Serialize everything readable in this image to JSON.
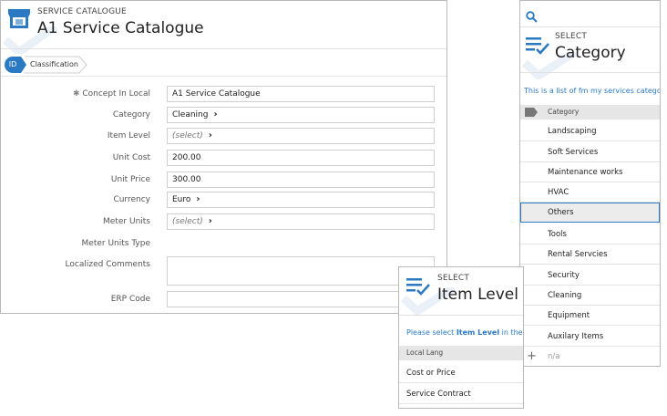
{
  "main": {
    "eyebrow": "SERVICE CATALOGUE",
    "title": "A1 Service Catalogue",
    "crumbs": {
      "id": "ID",
      "classification": "Classification"
    },
    "fields": [
      {
        "label": "Concept In Local",
        "value": "A1 Service Catalogue",
        "required": true
      },
      {
        "label": "Category",
        "value": "Cleaning",
        "chevron": true
      },
      {
        "label": "Item Level",
        "value": "(select)",
        "chevron": true,
        "placeholder": true
      },
      {
        "label": "Unit Cost",
        "value": "200.00"
      },
      {
        "label": "Unit Price",
        "value": "300.00"
      },
      {
        "label": "Currency",
        "value": "Euro",
        "chevron": true
      },
      {
        "label": "Meter Units",
        "value": "(select)",
        "chevron": true,
        "placeholder": true
      },
      {
        "label": "Meter Units Type",
        "value": ""
      },
      {
        "label": "Localized Comments",
        "value": ""
      },
      {
        "label": "ERP Code",
        "value": ""
      }
    ]
  },
  "category_panel": {
    "eyebrow": "SELECT",
    "title": "Category",
    "info": "This is a list of fm my services catego",
    "column": "Category",
    "items": [
      "Landscaping",
      "Soft Services",
      "Maintenance works",
      "HVAC",
      "Others",
      "Tools",
      "Rental Servcies",
      "Security",
      "Cleaning",
      "Equipment",
      "Auxilary Items"
    ],
    "selected_index": 4,
    "add_placeholder": "n/a"
  },
  "item_panel": {
    "eyebrow": "SELECT",
    "title": "Item Level",
    "info_prefix": "Please select ",
    "info_bold": "Item Level",
    "info_suffix": " in the l",
    "column": "Local Lang",
    "items": [
      "Cost or Price",
      "Service Contract"
    ]
  },
  "colors": {
    "accent": "#2b79c2",
    "border": "#b9b9b9"
  }
}
